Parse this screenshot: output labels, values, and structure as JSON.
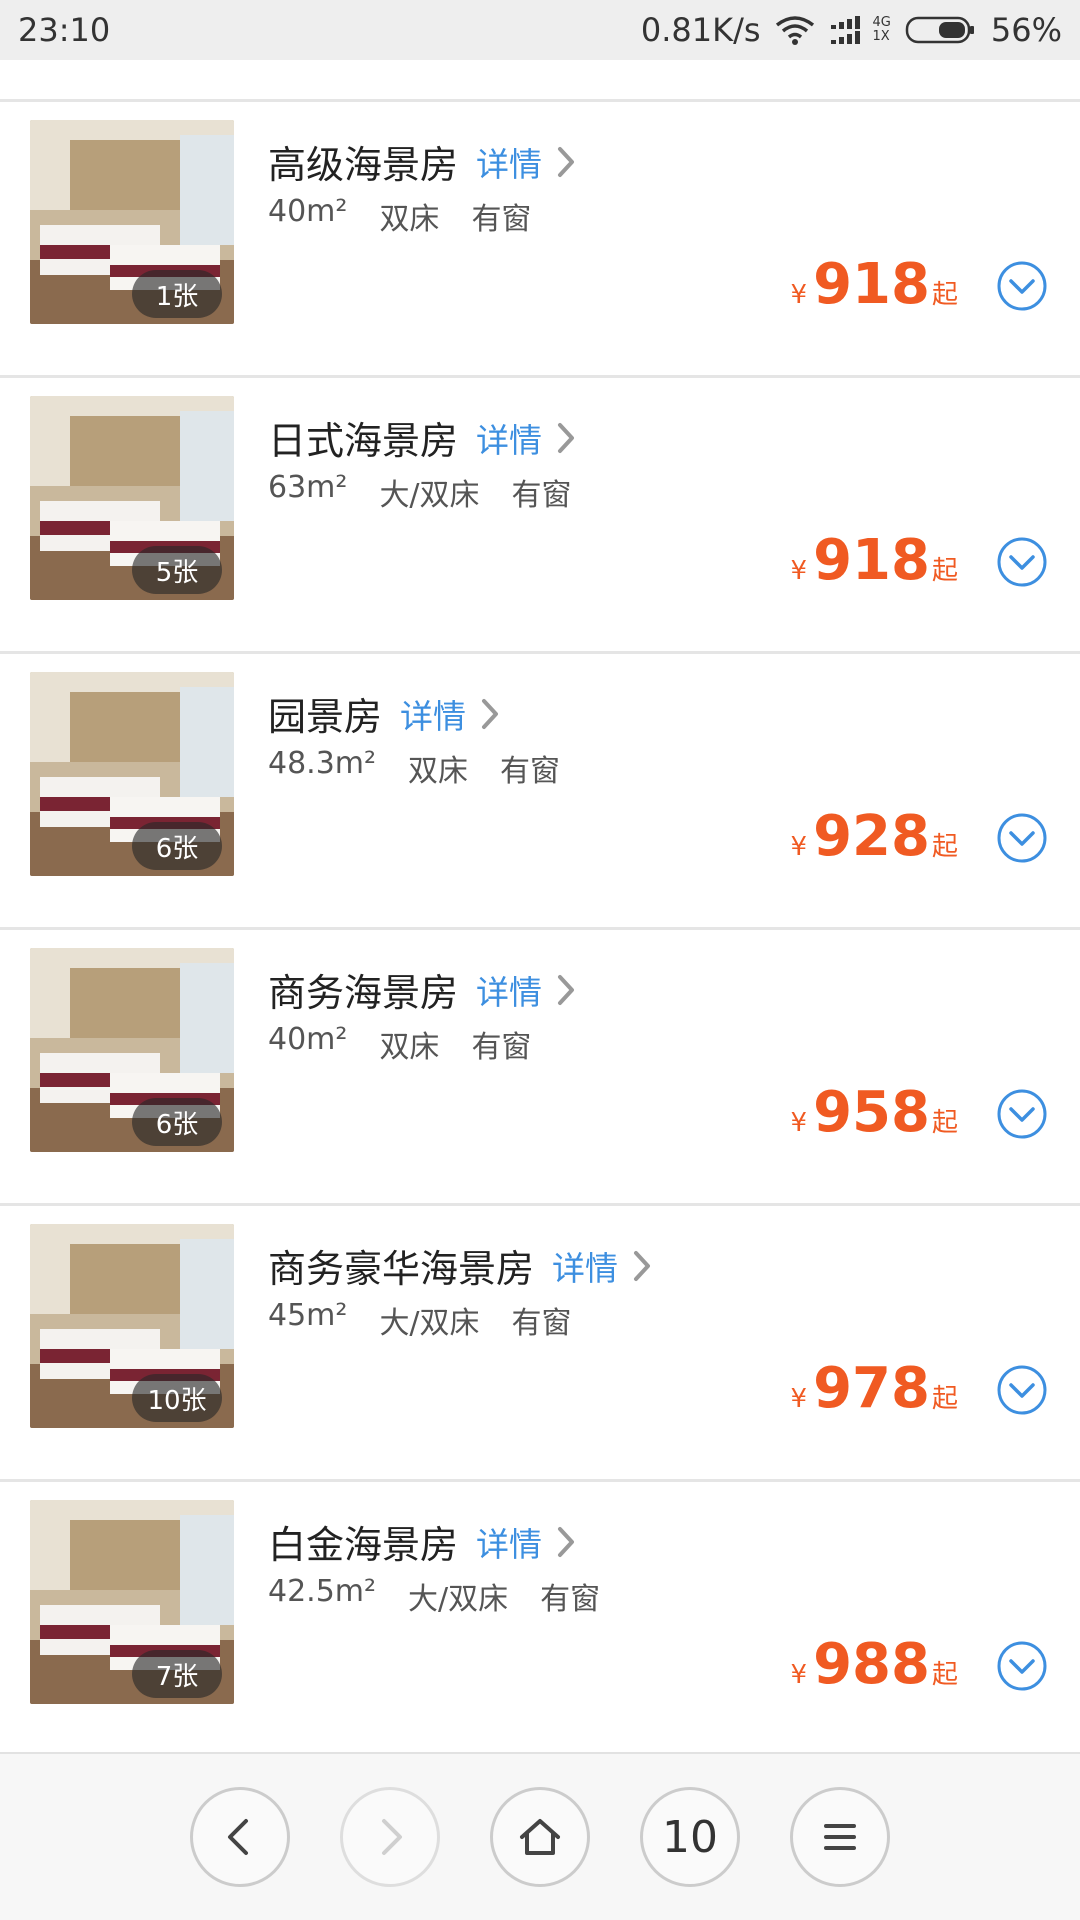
{
  "status_bar": {
    "time": "23:10",
    "net_speed": "0.81K/s",
    "net_type_top": "4G",
    "net_type_bottom": "1X",
    "battery": "56%"
  },
  "colors": {
    "price": "#f05a22",
    "link": "#3d8fe0",
    "divider": "#e5e5e5"
  },
  "rooms": [
    {
      "name": "高级海景房",
      "detail_label": "详情",
      "area": "40m²",
      "bed": "双床",
      "window": "有窗",
      "currency": "¥",
      "price": "918",
      "price_suffix": "起",
      "photo_count": "1张"
    },
    {
      "name": "日式海景房",
      "detail_label": "详情",
      "area": "63m²",
      "bed": "大/双床",
      "window": "有窗",
      "currency": "¥",
      "price": "918",
      "price_suffix": "起",
      "photo_count": "5张"
    },
    {
      "name": "园景房",
      "detail_label": "详情",
      "area": "48.3m²",
      "bed": "双床",
      "window": "有窗",
      "currency": "¥",
      "price": "928",
      "price_suffix": "起",
      "photo_count": "6张"
    },
    {
      "name": "商务海景房",
      "detail_label": "详情",
      "area": "40m²",
      "bed": "双床",
      "window": "有窗",
      "currency": "¥",
      "price": "958",
      "price_suffix": "起",
      "photo_count": "6张"
    },
    {
      "name": "商务豪华海景房",
      "detail_label": "详情",
      "area": "45m²",
      "bed": "大/双床",
      "window": "有窗",
      "currency": "¥",
      "price": "978",
      "price_suffix": "起",
      "photo_count": "10张"
    },
    {
      "name": "白金海景房",
      "detail_label": "详情",
      "area": "42.5m²",
      "bed": "大/双床",
      "window": "有窗",
      "currency": "¥",
      "price": "988",
      "price_suffix": "起",
      "photo_count": "7张"
    }
  ],
  "bottom_nav": {
    "tab_count": "10",
    "icons": [
      "back-icon",
      "forward-icon",
      "home-icon",
      "tabs-icon",
      "menu-icon"
    ]
  }
}
